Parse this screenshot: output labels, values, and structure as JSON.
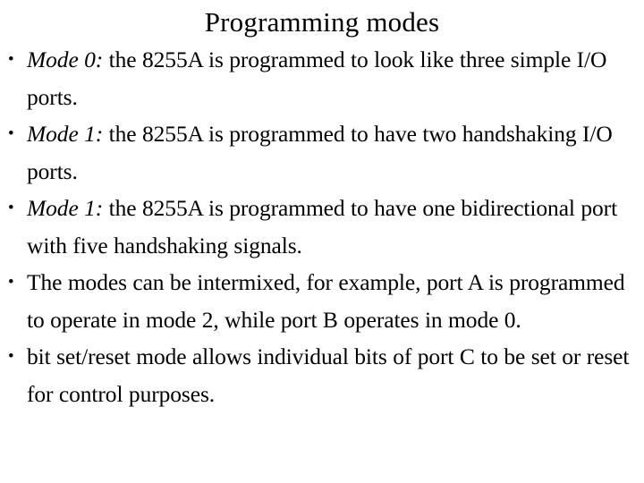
{
  "slide": {
    "title": "Programming modes",
    "bullet_marker": "•",
    "bullets": [
      {
        "emphasis": "Mode 0:",
        "text": " the 8255A is programmed to look like three simple I/O ports."
      },
      {
        "emphasis": "Mode 1:",
        "text": " the 8255A is programmed to have two handshaking I/O ports."
      },
      {
        "emphasis": "Mode 1:",
        "text": " the 8255A is programmed to have one bidirectional port with five handshaking signals."
      },
      {
        "emphasis": "",
        "text": "The modes can be intermixed, for example, port A is programmed to operate in mode 2, while port B operates in mode 0."
      },
      {
        "emphasis": "",
        "text": "bit set/reset mode allows individual bits of port C to be set or reset for control purposes."
      }
    ]
  }
}
